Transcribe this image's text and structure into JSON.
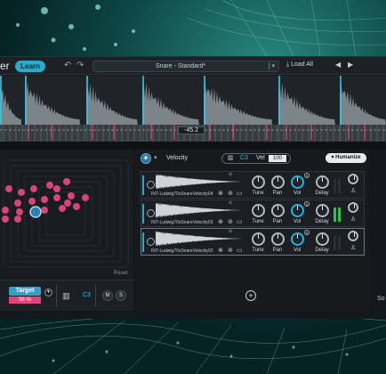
{
  "header": {
    "title_fragment": "er",
    "learn_label": "Learn",
    "undo_icon": "undo-icon",
    "redo_icon": "redo-icon",
    "preset_name": "Snare - Standard*",
    "load_all_label": "Load All",
    "prev_arrow": "◀",
    "next_arrow": "▶"
  },
  "waveform": {
    "peak_value": "-45.2"
  },
  "left_panel": {
    "reset_label": "Reset",
    "target_label": "Target",
    "target_percent": "98 %",
    "note": "C3",
    "mute_label": "M",
    "solo_label": "S"
  },
  "right_panel": {
    "mode_label": "Velocity",
    "note": "C3",
    "vel_label": "Vel",
    "vel_value": "100",
    "humanize_label": "Humanize",
    "slots": [
      {
        "name": "INT-Ludwig70sSnareVelocity04",
        "knobs": [
          "Tune",
          "Pan",
          "Vol",
          "Delay"
        ]
      },
      {
        "name": "INT-Ludwig70sSnareVelocity03",
        "knobs": [
          "Tune",
          "Pan",
          "Vol",
          "Delay"
        ]
      },
      {
        "name": "INT-Ludwig70sSnareVelocity02",
        "knobs": [
          "Tune",
          "Pan",
          "Vol",
          "Delay"
        ]
      }
    ]
  },
  "side_fragment": "So",
  "colors": {
    "accent": "#2aa9c8",
    "pink": "#e0457a",
    "meter_green": "#2ec24a",
    "background": "#0b3a3a"
  }
}
